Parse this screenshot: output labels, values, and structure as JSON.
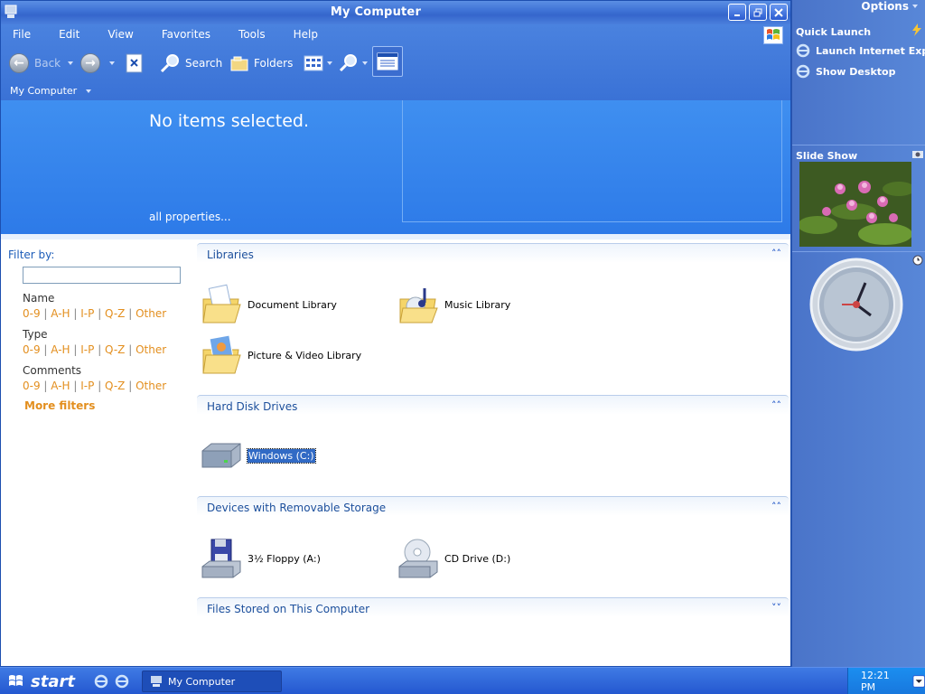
{
  "window": {
    "title": "My Computer"
  },
  "menu": [
    "File",
    "Edit",
    "View",
    "Favorites",
    "Tools",
    "Help"
  ],
  "toolbar": {
    "back_label": "Back",
    "search_label": "Search",
    "folders_label": "Folders"
  },
  "address": {
    "label": "My Computer"
  },
  "details": {
    "status": "No items selected.",
    "all_properties": "all properties..."
  },
  "filter": {
    "label": "Filter by:",
    "input_value": "",
    "groups": [
      {
        "name": "Name",
        "links": [
          "0-9",
          "A-H",
          "I-P",
          "Q-Z",
          "Other"
        ]
      },
      {
        "name": "Type",
        "links": [
          "0-9",
          "A-H",
          "I-P",
          "Q-Z",
          "Other"
        ]
      },
      {
        "name": "Comments",
        "links": [
          "0-9",
          "A-H",
          "I-P",
          "Q-Z",
          "Other"
        ]
      }
    ],
    "more": "More filters"
  },
  "sections": {
    "libraries": {
      "title": "Libraries",
      "items": [
        "Document Library",
        "Music Library",
        "Picture & Video Library"
      ]
    },
    "hard_disks": {
      "title": "Hard Disk Drives",
      "items": [
        "Windows (C:)"
      ]
    },
    "removable": {
      "title": "Devices with Removable Storage",
      "items": [
        "3½ Floppy (A:)",
        "CD Drive (D:)"
      ]
    },
    "files_stored": {
      "title": "Files Stored on This Computer"
    }
  },
  "sidebar": {
    "options": "Options",
    "quick_launch": "Quick Launch",
    "links": [
      "Launch Internet Explorer",
      "Show Desktop"
    ],
    "slideshow": "Slide Show"
  },
  "taskbar": {
    "start": "start",
    "task": "My Computer",
    "clock": "12:21 PM"
  },
  "colors": {
    "accent": "#3566cc",
    "link_orange": "#e38f1f",
    "details_blue": "#2d7ae8",
    "selection": "#316ac5"
  }
}
